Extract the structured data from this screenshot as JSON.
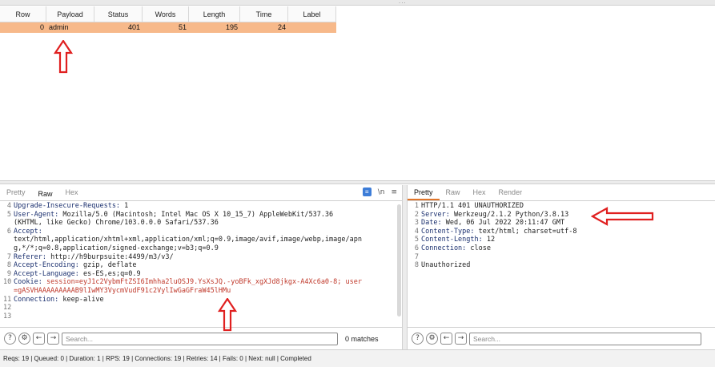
{
  "results": {
    "columns": [
      "Row",
      "Payload",
      "Status",
      "Words",
      "Length",
      "Time",
      "Label"
    ],
    "rows": [
      {
        "row": "0",
        "payload": "admin",
        "status": "401",
        "words": "51",
        "length": "195",
        "time": "24",
        "label": ""
      }
    ]
  },
  "request": {
    "tabs": [
      "Pretty",
      "Raw",
      "Hex"
    ],
    "active_tab": "Raw",
    "icons": [
      "message-format-icon",
      "newline-icon",
      "menu-icon"
    ],
    "newline_label": "\\n",
    "lines": [
      {
        "n": "4",
        "key": "Upgrade-Insecure-Requests:",
        "value": " 1"
      },
      {
        "n": "5",
        "key": "User-Agent:",
        "value": " Mozilla/5.0 (Macintosh; Intel Mac OS X 10_15_7) AppleWebKit/537.36"
      },
      {
        "n": "",
        "key": "",
        "value": "(KHTML, like Gecko) Chrome/103.0.0.0 Safari/537.36"
      },
      {
        "n": "6",
        "key": "Accept:",
        "value": ""
      },
      {
        "n": "",
        "key": "",
        "value": "text/html,application/xhtml+xml,application/xml;q=0.9,image/avif,image/webp,image/apn"
      },
      {
        "n": "",
        "key": "",
        "value": "g,*/*;q=0.8,application/signed-exchange;v=b3;q=0.9"
      },
      {
        "n": "7",
        "key": "Referer:",
        "value": " http://h9burpsuite:4499/m3/v3/"
      },
      {
        "n": "8",
        "key": "Accept-Encoding:",
        "value": " gzip, deflate"
      },
      {
        "n": "9",
        "key": "Accept-Language:",
        "value": " es-ES,es;q=0.9"
      },
      {
        "n": "10",
        "key": "Cookie:",
        "value": " session=eyJ1c2VybmFtZSI6Imhha2luOSJ9.YsXsJQ.-yoBFk_xgXJd8jkgx-A4Xc6a0-8; user",
        "cookie": true
      },
      {
        "n": "",
        "key": "",
        "value": "=gASVHAAAAAAAAAB9lIwMY3VycmVudF91c2VylIwGaGFraW45lHMu",
        "cookie": true
      },
      {
        "n": "11",
        "key": "Connection:",
        "value": " keep-alive"
      },
      {
        "n": "12",
        "key": "",
        "value": ""
      },
      {
        "n": "13",
        "key": "",
        "value": ""
      }
    ],
    "search_placeholder": "Search...",
    "matches": "0 matches"
  },
  "response": {
    "tabs": [
      "Pretty",
      "Raw",
      "Hex",
      "Render"
    ],
    "active_tab": "Pretty",
    "lines": [
      {
        "n": "1",
        "key": "",
        "value": "HTTP/1.1 401 UNAUTHORIZED"
      },
      {
        "n": "2",
        "key": "Server:",
        "value": " Werkzeug/2.1.2 Python/3.8.13"
      },
      {
        "n": "3",
        "key": "Date:",
        "value": " Wed, 06 Jul 2022 20:11:47 GMT"
      },
      {
        "n": "4",
        "key": "Content-Type:",
        "value": " text/html; charset=utf-8"
      },
      {
        "n": "5",
        "key": "Content-Length:",
        "value": " 12"
      },
      {
        "n": "6",
        "key": "Connection:",
        "value": " close"
      },
      {
        "n": "7",
        "key": "",
        "value": ""
      },
      {
        "n": "8",
        "key": "",
        "value": "Unauthorized"
      }
    ],
    "search_placeholder": "Search..."
  },
  "search_buttons": {
    "help": "?",
    "settings": "⚙",
    "prev": "←",
    "next": "→"
  },
  "status_bar": "Reqs: 19 | Queued: 0 | Duration: 1 | RPS: 19 | Connections: 19 | Retries: 14 | Fails: 0 | Next: null | Completed",
  "colors": {
    "highlight_row": "#f7b98a",
    "annotation_arrow": "#e02020",
    "active_tab": "#e0752a",
    "header_key": "#1a2f6e",
    "cookie": "#c0392b"
  }
}
